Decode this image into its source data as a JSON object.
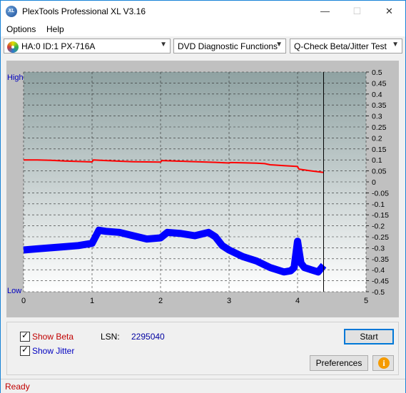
{
  "window": {
    "title": "PlexTools Professional XL V3.16",
    "icon_text": "XL",
    "controls": {
      "minimize": "—",
      "maximize": "☐",
      "close": "✕"
    }
  },
  "menu": {
    "items": [
      {
        "label": "Options",
        "key": "O"
      },
      {
        "label": "Help",
        "key": "H"
      }
    ]
  },
  "toolbar": {
    "drive": "HA:0 ID:1  PX-716A",
    "function": "DVD Diagnostic Functions",
    "test": "Q-Check Beta/Jitter Test"
  },
  "chart_data": {
    "type": "line",
    "title": "",
    "xlabel": "",
    "ylabel": "",
    "x_ticks": [
      "0",
      "1",
      "2",
      "3",
      "4",
      "5"
    ],
    "xlim": [
      0,
      5
    ],
    "y_left_labels": {
      "top": "High",
      "bottom": "Low"
    },
    "y_right_ticks": [
      "0.5",
      "0.45",
      "0.4",
      "0.35",
      "0.3",
      "0.25",
      "0.2",
      "0.15",
      "0.1",
      "0.05",
      "0",
      "-0.05",
      "-0.1",
      "-0.15",
      "-0.2",
      "-0.25",
      "-0.3",
      "-0.35",
      "-0.4",
      "-0.45",
      "-0.5"
    ],
    "ylim": [
      -0.5,
      0.5
    ],
    "grid": true,
    "end_marker_x": 4.38,
    "series": [
      {
        "color": "#ff0000",
        "x": [
          0,
          0.2,
          0.4,
          0.6,
          0.8,
          1.0,
          1.02,
          1.2,
          1.4,
          1.6,
          1.8,
          2.0,
          2.02,
          2.2,
          2.4,
          2.6,
          2.8,
          3.0,
          3.02,
          3.2,
          3.4,
          3.52,
          3.6,
          3.8,
          4.0,
          4.02,
          4.2,
          4.38
        ],
        "y": [
          0.1,
          0.1,
          0.098,
          0.095,
          0.093,
          0.091,
          0.1,
          0.097,
          0.094,
          0.092,
          0.091,
          0.09,
          0.097,
          0.095,
          0.093,
          0.091,
          0.089,
          0.086,
          0.088,
          0.087,
          0.085,
          0.083,
          0.078,
          0.074,
          0.07,
          0.058,
          0.05,
          0.043
        ]
      },
      {
        "color": "#0000ff",
        "x": [
          0,
          0.2,
          0.4,
          0.6,
          0.8,
          1.0,
          1.1,
          1.2,
          1.4,
          1.6,
          1.8,
          2.0,
          2.1,
          2.3,
          2.5,
          2.7,
          2.8,
          2.9,
          3.0,
          3.2,
          3.4,
          3.6,
          3.8,
          3.9,
          3.95,
          4.0,
          4.05,
          4.1,
          4.2,
          4.3,
          4.38
        ],
        "y": [
          -0.31,
          -0.305,
          -0.3,
          -0.295,
          -0.29,
          -0.28,
          -0.22,
          -0.225,
          -0.23,
          -0.245,
          -0.26,
          -0.255,
          -0.23,
          -0.235,
          -0.245,
          -0.23,
          -0.25,
          -0.29,
          -0.31,
          -0.34,
          -0.36,
          -0.39,
          -0.41,
          -0.405,
          -0.39,
          -0.27,
          -0.37,
          -0.39,
          -0.4,
          -0.41,
          -0.38
        ]
      }
    ]
  },
  "bottom": {
    "show_beta_label": "Show Beta",
    "show_jitter_label": "Show Jitter",
    "lsn_label": "LSN:",
    "lsn_value": "2295040",
    "start_label": "Start",
    "preferences_label": "Preferences",
    "info_glyph": "i",
    "beta_color": "#c00000",
    "jitter_color": "#0000c0"
  },
  "status": {
    "text": "Ready"
  }
}
